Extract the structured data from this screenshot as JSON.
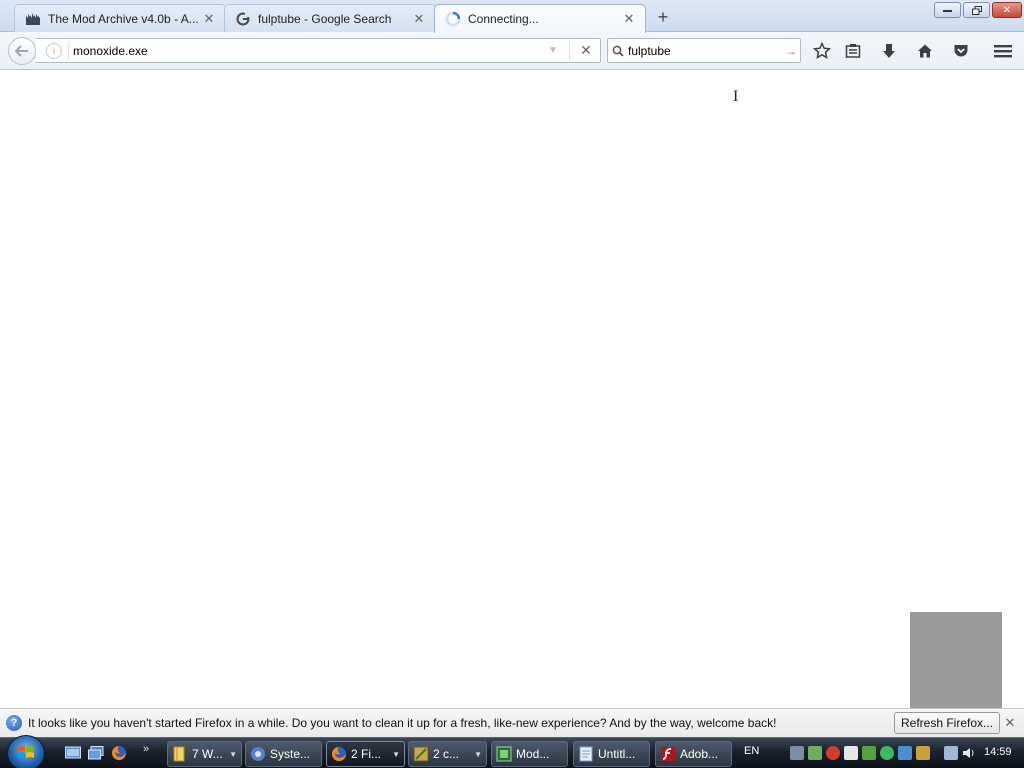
{
  "browser": {
    "tabs": [
      {
        "title": "The Mod Archive v4.0b - A...",
        "icon": "mod-archive-icon"
      },
      {
        "title": "fulptube - Google Search",
        "icon": "google-icon"
      },
      {
        "title": "Connecting...",
        "icon": "loading-spinner-icon"
      }
    ],
    "url": "monoxide.exe",
    "search_value": "fulptube",
    "toolbar_icons": [
      "bookmark-star-icon",
      "reading-list-icon",
      "downloads-icon",
      "home-icon",
      "pocket-icon",
      "menu-icon"
    ]
  },
  "notification": {
    "message": "It looks like you haven't started Firefox in a while. Do you want to clean it up for a fresh, like-new experience? And by the way, welcome back!",
    "button": "Refresh Firefox..."
  },
  "taskbar": {
    "items": [
      {
        "label": "7 W...",
        "icon": "folder-icon"
      },
      {
        "label": "Syste...",
        "icon": "system-icon"
      },
      {
        "label": "2 Fi...",
        "icon": "firefox-icon"
      },
      {
        "label": "2 c...",
        "icon": "app-icon"
      },
      {
        "label": "Mod...",
        "icon": "modplug-icon"
      },
      {
        "label": "Untitl...",
        "icon": "notepad-icon"
      },
      {
        "label": "Adob...",
        "icon": "adobe-flash-icon"
      }
    ],
    "language": "EN",
    "time": "14:59"
  },
  "colors": {
    "accent": "#2a7de1",
    "taskbar": "#1b222c",
    "close_red": "#c44a33"
  }
}
